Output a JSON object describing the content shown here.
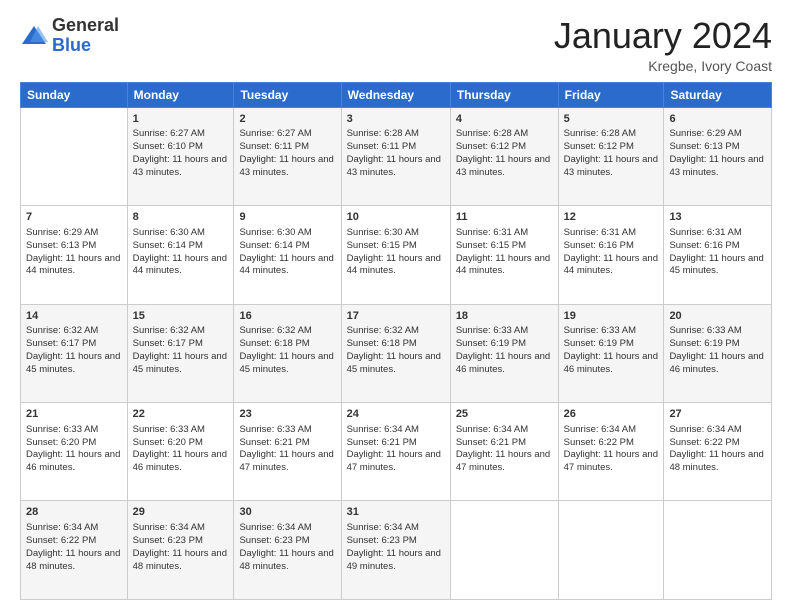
{
  "logo": {
    "general": "General",
    "blue": "Blue"
  },
  "header": {
    "month": "January 2024",
    "location": "Kregbe, Ivory Coast"
  },
  "days_of_week": [
    "Sunday",
    "Monday",
    "Tuesday",
    "Wednesday",
    "Thursday",
    "Friday",
    "Saturday"
  ],
  "weeks": [
    [
      {
        "day": "",
        "sunrise": "",
        "sunset": "",
        "daylight": ""
      },
      {
        "day": "1",
        "sunrise": "Sunrise: 6:27 AM",
        "sunset": "Sunset: 6:10 PM",
        "daylight": "Daylight: 11 hours and 43 minutes."
      },
      {
        "day": "2",
        "sunrise": "Sunrise: 6:27 AM",
        "sunset": "Sunset: 6:11 PM",
        "daylight": "Daylight: 11 hours and 43 minutes."
      },
      {
        "day": "3",
        "sunrise": "Sunrise: 6:28 AM",
        "sunset": "Sunset: 6:11 PM",
        "daylight": "Daylight: 11 hours and 43 minutes."
      },
      {
        "day": "4",
        "sunrise": "Sunrise: 6:28 AM",
        "sunset": "Sunset: 6:12 PM",
        "daylight": "Daylight: 11 hours and 43 minutes."
      },
      {
        "day": "5",
        "sunrise": "Sunrise: 6:28 AM",
        "sunset": "Sunset: 6:12 PM",
        "daylight": "Daylight: 11 hours and 43 minutes."
      },
      {
        "day": "6",
        "sunrise": "Sunrise: 6:29 AM",
        "sunset": "Sunset: 6:13 PM",
        "daylight": "Daylight: 11 hours and 43 minutes."
      }
    ],
    [
      {
        "day": "7",
        "sunrise": "Sunrise: 6:29 AM",
        "sunset": "Sunset: 6:13 PM",
        "daylight": "Daylight: 11 hours and 44 minutes."
      },
      {
        "day": "8",
        "sunrise": "Sunrise: 6:30 AM",
        "sunset": "Sunset: 6:14 PM",
        "daylight": "Daylight: 11 hours and 44 minutes."
      },
      {
        "day": "9",
        "sunrise": "Sunrise: 6:30 AM",
        "sunset": "Sunset: 6:14 PM",
        "daylight": "Daylight: 11 hours and 44 minutes."
      },
      {
        "day": "10",
        "sunrise": "Sunrise: 6:30 AM",
        "sunset": "Sunset: 6:15 PM",
        "daylight": "Daylight: 11 hours and 44 minutes."
      },
      {
        "day": "11",
        "sunrise": "Sunrise: 6:31 AM",
        "sunset": "Sunset: 6:15 PM",
        "daylight": "Daylight: 11 hours and 44 minutes."
      },
      {
        "day": "12",
        "sunrise": "Sunrise: 6:31 AM",
        "sunset": "Sunset: 6:16 PM",
        "daylight": "Daylight: 11 hours and 44 minutes."
      },
      {
        "day": "13",
        "sunrise": "Sunrise: 6:31 AM",
        "sunset": "Sunset: 6:16 PM",
        "daylight": "Daylight: 11 hours and 45 minutes."
      }
    ],
    [
      {
        "day": "14",
        "sunrise": "Sunrise: 6:32 AM",
        "sunset": "Sunset: 6:17 PM",
        "daylight": "Daylight: 11 hours and 45 minutes."
      },
      {
        "day": "15",
        "sunrise": "Sunrise: 6:32 AM",
        "sunset": "Sunset: 6:17 PM",
        "daylight": "Daylight: 11 hours and 45 minutes."
      },
      {
        "day": "16",
        "sunrise": "Sunrise: 6:32 AM",
        "sunset": "Sunset: 6:18 PM",
        "daylight": "Daylight: 11 hours and 45 minutes."
      },
      {
        "day": "17",
        "sunrise": "Sunrise: 6:32 AM",
        "sunset": "Sunset: 6:18 PM",
        "daylight": "Daylight: 11 hours and 45 minutes."
      },
      {
        "day": "18",
        "sunrise": "Sunrise: 6:33 AM",
        "sunset": "Sunset: 6:19 PM",
        "daylight": "Daylight: 11 hours and 46 minutes."
      },
      {
        "day": "19",
        "sunrise": "Sunrise: 6:33 AM",
        "sunset": "Sunset: 6:19 PM",
        "daylight": "Daylight: 11 hours and 46 minutes."
      },
      {
        "day": "20",
        "sunrise": "Sunrise: 6:33 AM",
        "sunset": "Sunset: 6:19 PM",
        "daylight": "Daylight: 11 hours and 46 minutes."
      }
    ],
    [
      {
        "day": "21",
        "sunrise": "Sunrise: 6:33 AM",
        "sunset": "Sunset: 6:20 PM",
        "daylight": "Daylight: 11 hours and 46 minutes."
      },
      {
        "day": "22",
        "sunrise": "Sunrise: 6:33 AM",
        "sunset": "Sunset: 6:20 PM",
        "daylight": "Daylight: 11 hours and 46 minutes."
      },
      {
        "day": "23",
        "sunrise": "Sunrise: 6:33 AM",
        "sunset": "Sunset: 6:21 PM",
        "daylight": "Daylight: 11 hours and 47 minutes."
      },
      {
        "day": "24",
        "sunrise": "Sunrise: 6:34 AM",
        "sunset": "Sunset: 6:21 PM",
        "daylight": "Daylight: 11 hours and 47 minutes."
      },
      {
        "day": "25",
        "sunrise": "Sunrise: 6:34 AM",
        "sunset": "Sunset: 6:21 PM",
        "daylight": "Daylight: 11 hours and 47 minutes."
      },
      {
        "day": "26",
        "sunrise": "Sunrise: 6:34 AM",
        "sunset": "Sunset: 6:22 PM",
        "daylight": "Daylight: 11 hours and 47 minutes."
      },
      {
        "day": "27",
        "sunrise": "Sunrise: 6:34 AM",
        "sunset": "Sunset: 6:22 PM",
        "daylight": "Daylight: 11 hours and 48 minutes."
      }
    ],
    [
      {
        "day": "28",
        "sunrise": "Sunrise: 6:34 AM",
        "sunset": "Sunset: 6:22 PM",
        "daylight": "Daylight: 11 hours and 48 minutes."
      },
      {
        "day": "29",
        "sunrise": "Sunrise: 6:34 AM",
        "sunset": "Sunset: 6:23 PM",
        "daylight": "Daylight: 11 hours and 48 minutes."
      },
      {
        "day": "30",
        "sunrise": "Sunrise: 6:34 AM",
        "sunset": "Sunset: 6:23 PM",
        "daylight": "Daylight: 11 hours and 48 minutes."
      },
      {
        "day": "31",
        "sunrise": "Sunrise: 6:34 AM",
        "sunset": "Sunset: 6:23 PM",
        "daylight": "Daylight: 11 hours and 49 minutes."
      },
      {
        "day": "",
        "sunrise": "",
        "sunset": "",
        "daylight": ""
      },
      {
        "day": "",
        "sunrise": "",
        "sunset": "",
        "daylight": ""
      },
      {
        "day": "",
        "sunrise": "",
        "sunset": "",
        "daylight": ""
      }
    ]
  ]
}
